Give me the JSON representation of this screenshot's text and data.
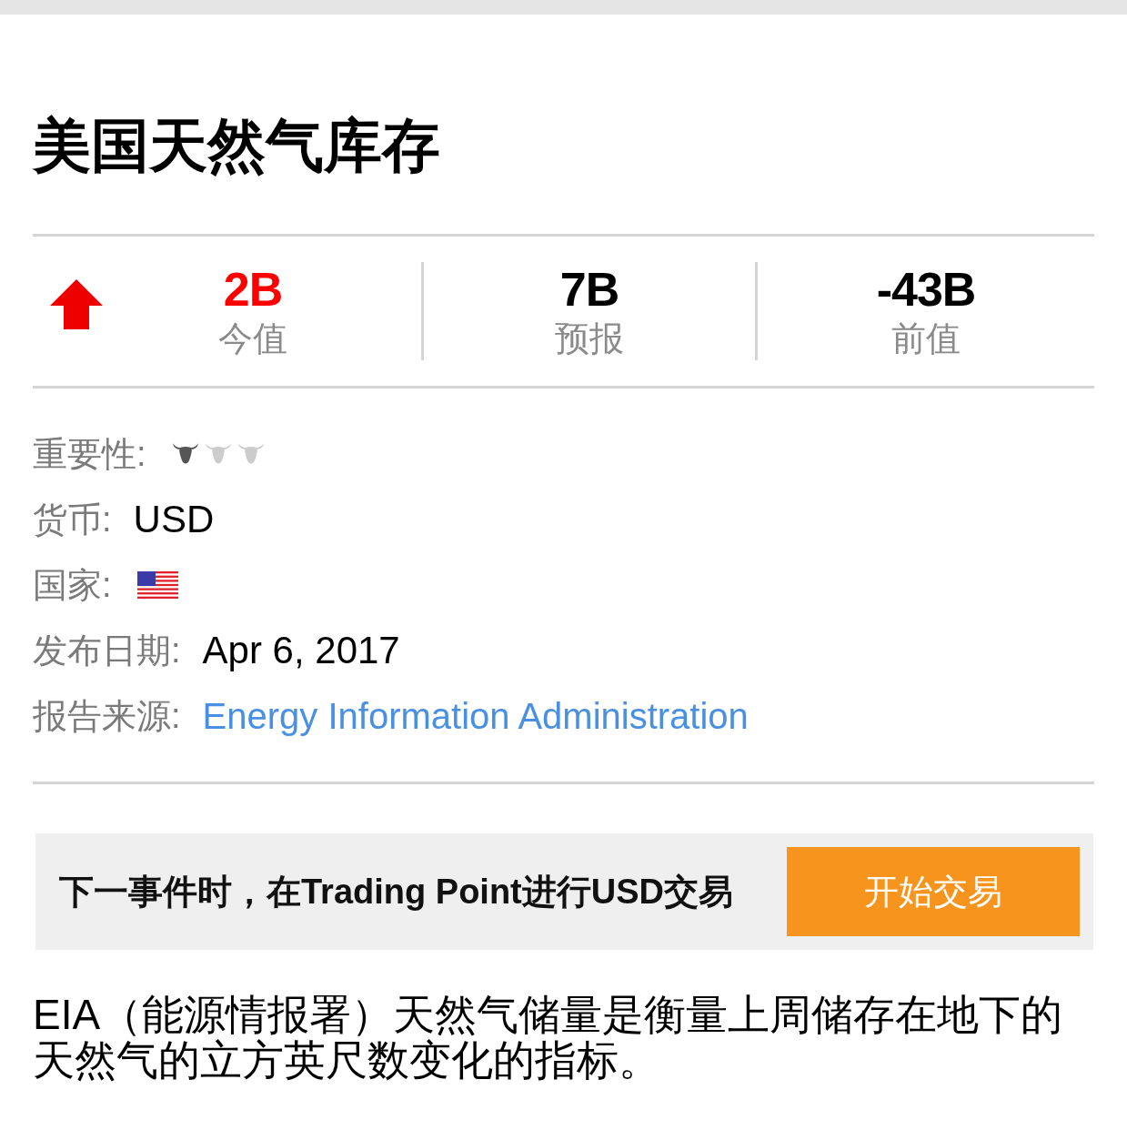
{
  "title": "美国天然气库存",
  "stats": {
    "rising": true,
    "items": [
      {
        "value": "2B",
        "label": "今值",
        "color": "#ff0000"
      },
      {
        "value": "7B",
        "label": "预报",
        "color": "#000000"
      },
      {
        "value": "-43B",
        "label": "前值",
        "color": "#000000"
      }
    ]
  },
  "details": [
    {
      "kind": "importance",
      "label": "重要性:",
      "stars": 1
    },
    {
      "kind": "text",
      "label": "货币:",
      "value": "USD"
    },
    {
      "kind": "flag",
      "label": "国家:"
    },
    {
      "kind": "text",
      "label": "发布日期:",
      "value": "Apr 6, 2017"
    },
    {
      "kind": "link",
      "label": "报告来源:",
      "value": "Energy Information Administration"
    }
  ],
  "promo": {
    "text": "下一事件时，在Trading Point进行USD交易",
    "button": "开始交易"
  },
  "description": "EIA（能源情报署）天然气储量是衡量上周储存在地下的天然气的立方英尺数变化的指标。"
}
